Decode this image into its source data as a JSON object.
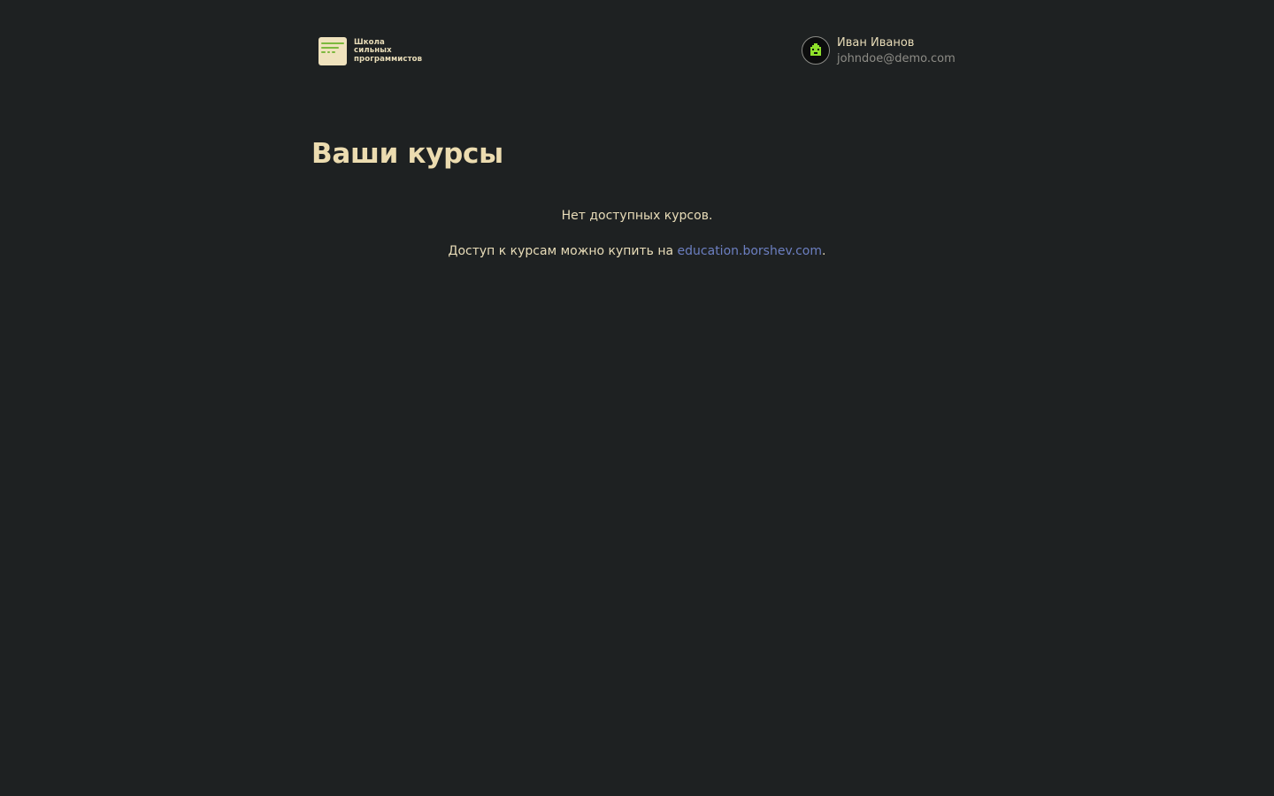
{
  "header": {
    "logo": {
      "line1": "Школа",
      "line2": "сильных",
      "line3": "программистов"
    },
    "user": {
      "name": "Иван Иванов",
      "email": "johndoe@demo.com"
    }
  },
  "main": {
    "title": "Ваши курсы",
    "empty_message": "Нет доступных курсов.",
    "purchase_text": "Доступ к курсам можно купить на ",
    "purchase_link": "education.borshev.com",
    "purchase_suffix": "."
  },
  "colors": {
    "background": "#1e2122",
    "text": "#e8dcb8",
    "muted": "#8d8c86",
    "link": "#6c7fc1",
    "logo_bg": "#efe2bd",
    "logo_accent": "#7cb83e",
    "avatar_accent": "#8ee02a"
  },
  "icons": {
    "logo": "school-logo-icon",
    "avatar": "pixel-avatar-icon"
  }
}
